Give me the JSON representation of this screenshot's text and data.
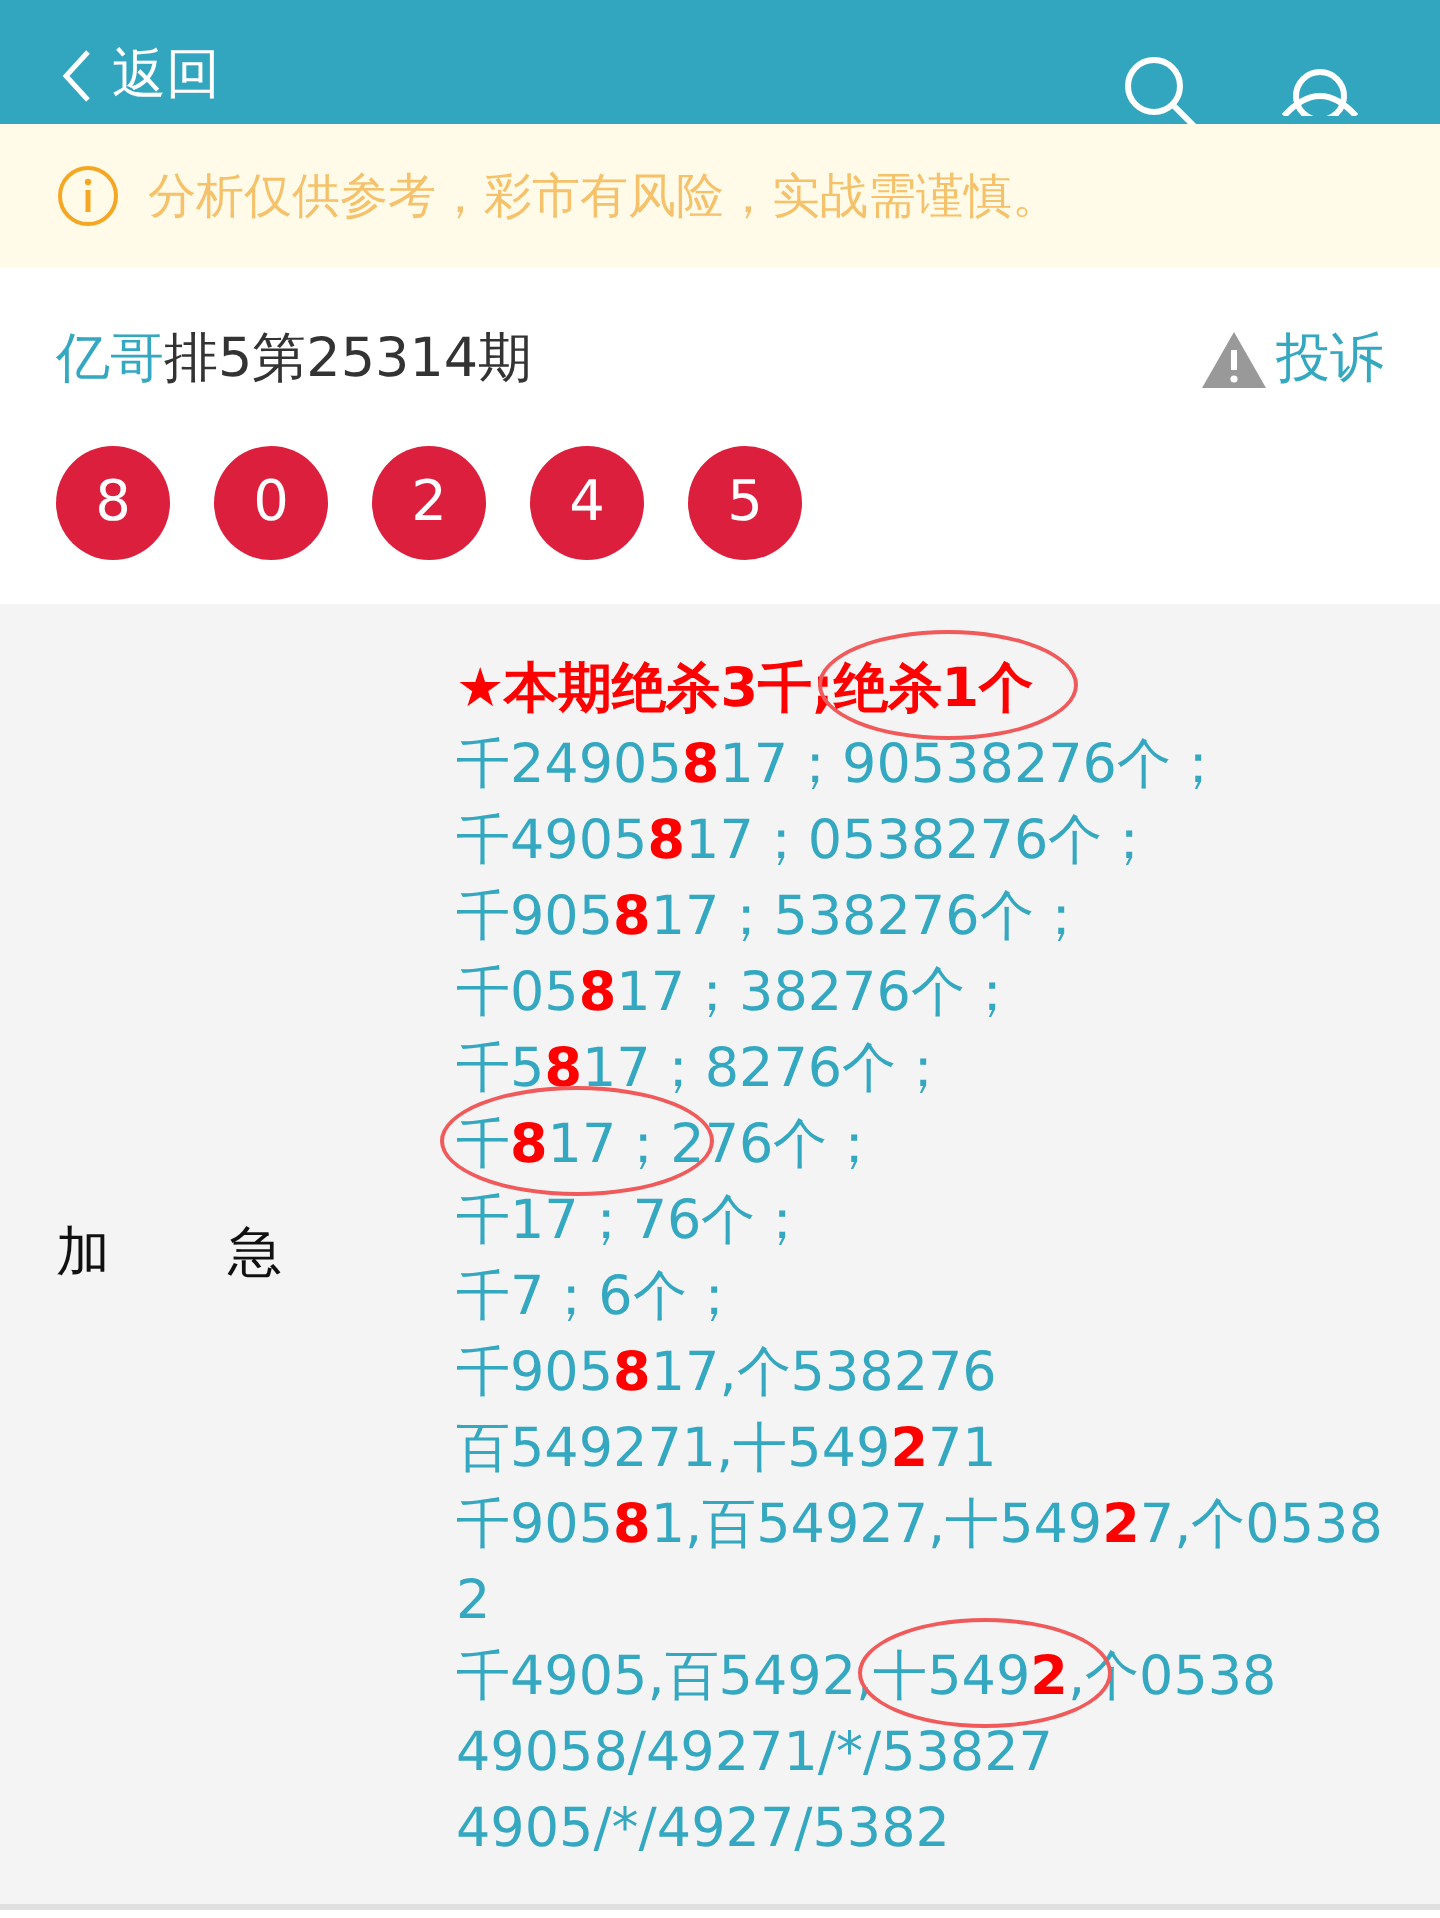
{
  "header": {
    "back_label": "返回"
  },
  "notice": {
    "text": "分析仅供参考，彩市有风险，实战需谨慎。"
  },
  "issue": {
    "author": "亿哥",
    "title": "排5第25314期",
    "complaint_label": "投诉",
    "balls": [
      "8",
      "0",
      "2",
      "4",
      "5"
    ]
  },
  "analysis": {
    "label": "加　急",
    "lines": [
      [
        {
          "circled": false,
          "segments": [
            {
              "text": "★本期绝杀3千;",
              "kind": "title"
            }
          ]
        },
        {
          "circled": true,
          "segments": [
            {
              "text": "绝杀1个",
              "kind": "title"
            }
          ]
        }
      ],
      [
        {
          "circled": false,
          "segments": [
            {
              "text": "千24905",
              "kind": "normal"
            },
            {
              "text": "8",
              "kind": "hit"
            },
            {
              "text": "17；90538276个；",
              "kind": "normal"
            }
          ]
        }
      ],
      [
        {
          "circled": false,
          "segments": [
            {
              "text": "千4905",
              "kind": "normal"
            },
            {
              "text": "8",
              "kind": "hit"
            },
            {
              "text": "17；0538276个；",
              "kind": "normal"
            }
          ]
        }
      ],
      [
        {
          "circled": false,
          "segments": [
            {
              "text": "千905",
              "kind": "normal"
            },
            {
              "text": "8",
              "kind": "hit"
            },
            {
              "text": "17；538276个；",
              "kind": "normal"
            }
          ]
        }
      ],
      [
        {
          "circled": false,
          "segments": [
            {
              "text": "千05",
              "kind": "normal"
            },
            {
              "text": "8",
              "kind": "hit"
            },
            {
              "text": "17；38276个；",
              "kind": "normal"
            }
          ]
        }
      ],
      [
        {
          "circled": false,
          "segments": [
            {
              "text": "千5",
              "kind": "normal"
            },
            {
              "text": "8",
              "kind": "hit"
            },
            {
              "text": "17；8276个；",
              "kind": "normal"
            }
          ]
        }
      ],
      [
        {
          "circled": true,
          "segments": [
            {
              "text": "千",
              "kind": "normal"
            },
            {
              "text": "8",
              "kind": "hit"
            },
            {
              "text": "17；",
              "kind": "normal"
            }
          ]
        },
        {
          "circled": false,
          "segments": [
            {
              "text": "276个；",
              "kind": "normal"
            }
          ]
        }
      ],
      [
        {
          "circled": false,
          "segments": [
            {
              "text": "千17；76个；",
              "kind": "normal"
            }
          ]
        }
      ],
      [
        {
          "circled": false,
          "segments": [
            {
              "text": "千7；6个；",
              "kind": "normal"
            }
          ]
        }
      ],
      [
        {
          "circled": false,
          "segments": [
            {
              "text": "千905",
              "kind": "normal"
            },
            {
              "text": "8",
              "kind": "hit"
            },
            {
              "text": "17,个538276",
              "kind": "normal"
            }
          ]
        }
      ],
      [
        {
          "circled": false,
          "segments": [
            {
              "text": "百549271,十549",
              "kind": "normal"
            },
            {
              "text": "2",
              "kind": "hit"
            },
            {
              "text": "71",
              "kind": "normal"
            }
          ]
        }
      ],
      [
        {
          "circled": false,
          "segments": [
            {
              "text": "千905",
              "kind": "normal"
            },
            {
              "text": "8",
              "kind": "hit"
            },
            {
              "text": "1,百54927,十549",
              "kind": "normal"
            },
            {
              "text": "2",
              "kind": "hit"
            },
            {
              "text": "7,个05382",
              "kind": "normal"
            }
          ]
        }
      ],
      [
        {
          "circled": false,
          "segments": [
            {
              "text": "千4905,百5492,",
              "kind": "normal"
            }
          ]
        },
        {
          "circled": true,
          "segments": [
            {
              "text": "十549",
              "kind": "normal"
            },
            {
              "text": "2",
              "kind": "hit"
            }
          ]
        },
        {
          "circled": false,
          "segments": [
            {
              "text": ",个0538",
              "kind": "normal"
            }
          ]
        }
      ],
      [
        {
          "circled": false,
          "segments": [
            {
              "text": "49058/49271/*/53827",
              "kind": "normal"
            }
          ]
        }
      ],
      [
        {
          "circled": false,
          "segments": [
            {
              "text": "4905/*/4927/5382",
              "kind": "normal"
            }
          ]
        }
      ]
    ]
  }
}
